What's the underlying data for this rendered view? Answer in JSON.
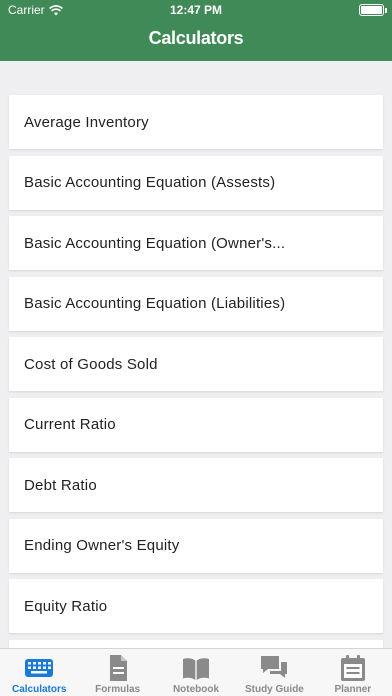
{
  "status_bar": {
    "carrier": "Carrier",
    "time": "12:47 PM"
  },
  "nav": {
    "title": "Calculators"
  },
  "colors": {
    "header": "#3f8a57",
    "active_tab": "#1a7ad9",
    "inactive_tab": "#8a8a8a"
  },
  "items": [
    {
      "label": "Average Inventory"
    },
    {
      "label": "Basic Accounting Equation (Assests)"
    },
    {
      "label": "Basic Accounting Equation (Owner's..."
    },
    {
      "label": "Basic Accounting Equation (Liabilities)"
    },
    {
      "label": "Cost of Goods Sold"
    },
    {
      "label": "Current Ratio"
    },
    {
      "label": "Debt Ratio"
    },
    {
      "label": "Ending Owner's Equity"
    },
    {
      "label": "Equity Ratio"
    }
  ],
  "tabs": [
    {
      "label": "Calculators",
      "icon": "keyboard-icon",
      "active": true
    },
    {
      "label": "Formulas",
      "icon": "document-icon",
      "active": false
    },
    {
      "label": "Notebook",
      "icon": "book-icon",
      "active": false
    },
    {
      "label": "Study Guide",
      "icon": "chat-bubbles-icon",
      "active": false
    },
    {
      "label": "Planner",
      "icon": "calendar-icon",
      "active": false
    }
  ]
}
